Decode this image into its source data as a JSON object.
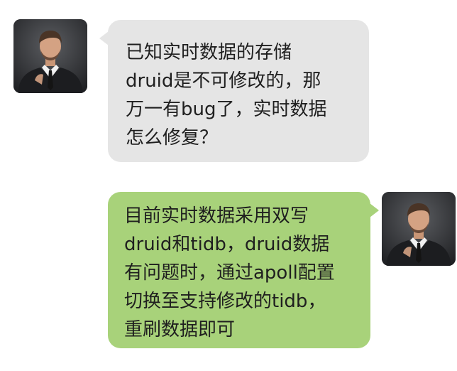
{
  "colors": {
    "incoming_bubble": "#e5e5e5",
    "outgoing_bubble": "#a8d27a",
    "text": "#1f1f1f",
    "background": "#ffffff"
  },
  "messages": [
    {
      "side": "left",
      "avatar": "man-in-suit-avatar",
      "lines": [
        "已知实时数据的存储",
        "druid是不可修改的，那",
        "万一有bug了，实时数据",
        "怎么修复？"
      ]
    },
    {
      "side": "right",
      "avatar": "man-in-suit-avatar",
      "lines": [
        "目前实时数据采用双写",
        "druid和tidb，druid数据",
        "有问题时，通过apoll配置",
        "切换至支持修改的tidb，",
        "重刷数据即可"
      ]
    }
  ]
}
